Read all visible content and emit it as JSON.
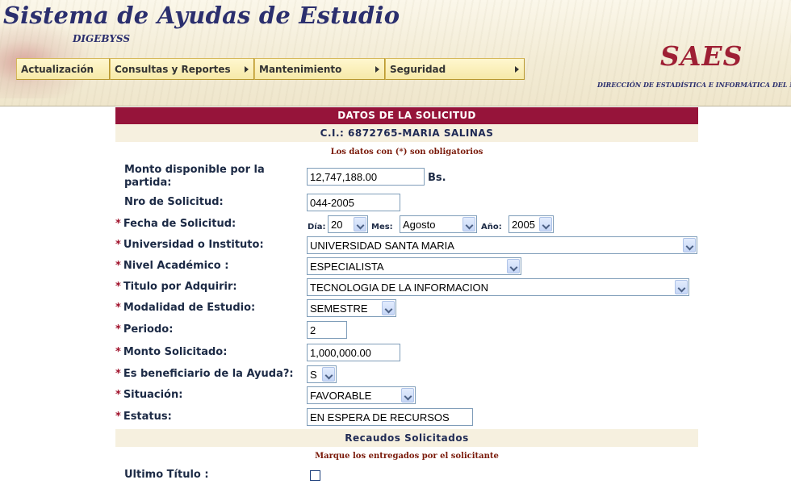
{
  "header": {
    "app_title": "Sistema de Ayudas de Estudio",
    "app_subtitle": "DIGEBYSS",
    "brand": "SAES",
    "brand_subtitle": "DIRECCIÓN DE ESTADÍSTICA E INFORMÁTICA DEL MI",
    "menu": [
      {
        "label": "Actualización",
        "has_submenu": false
      },
      {
        "label": "Consultas y Reportes",
        "has_submenu": true
      },
      {
        "label": "Mantenimiento",
        "has_submenu": true
      },
      {
        "label": "Seguridad",
        "has_submenu": true
      }
    ],
    "colors": {
      "title": "#2b2f6e",
      "brand": "#9e1f34",
      "menu_bg": "#f6e9a8"
    }
  },
  "form": {
    "section_title": "DATOS DE LA SOLICITUD",
    "applicant": "C.I.: 6872765-MARIA SALINAS",
    "required_note": "Los datos con (*) son obligatorios",
    "required_mark": "*",
    "colors": {
      "band": "#96143a",
      "required": "#a0102a"
    },
    "fields": {
      "monto_disponible": {
        "label": "Monto disponible por la partida:",
        "value": "12,747,188.00",
        "unit": "Bs."
      },
      "nro_solicitud": {
        "label": "Nro de Solicitud:",
        "value": "044-2005"
      },
      "fecha_solicitud": {
        "label": "Fecha de Solicitud:",
        "dia_label": "Día:",
        "dia": "20",
        "mes_label": "Mes:",
        "mes": "Agosto",
        "anio_label": "Año:",
        "anio": "2005"
      },
      "universidad": {
        "label": "Universidad o Instituto:",
        "value": "UNIVERSIDAD SANTA MARIA"
      },
      "nivel": {
        "label": "Nivel Académico :",
        "value": "ESPECIALISTA"
      },
      "titulo": {
        "label": "Titulo por Adquirir:",
        "value": "TECNOLOGIA DE LA INFORMACION"
      },
      "modalidad": {
        "label": "Modalidad de Estudio:",
        "value": "SEMESTRE"
      },
      "periodo": {
        "label": "Periodo:",
        "value": "2"
      },
      "monto_solicitado": {
        "label": "Monto Solicitado:",
        "value": "1,000,000.00"
      },
      "beneficiario": {
        "label": "Es beneficiario de la Ayuda?:",
        "value": "S"
      },
      "situacion": {
        "label": "Situación:",
        "value": "FAVORABLE"
      },
      "estatus": {
        "label": "Estatus:",
        "value": "EN ESPERA DE RECURSOS"
      }
    },
    "recaudos": {
      "title": "Recaudos Solicitados",
      "note": "Marque los entregados por el solicitante",
      "items": [
        {
          "label": "Ultimo Título :",
          "checked": false
        }
      ]
    }
  }
}
